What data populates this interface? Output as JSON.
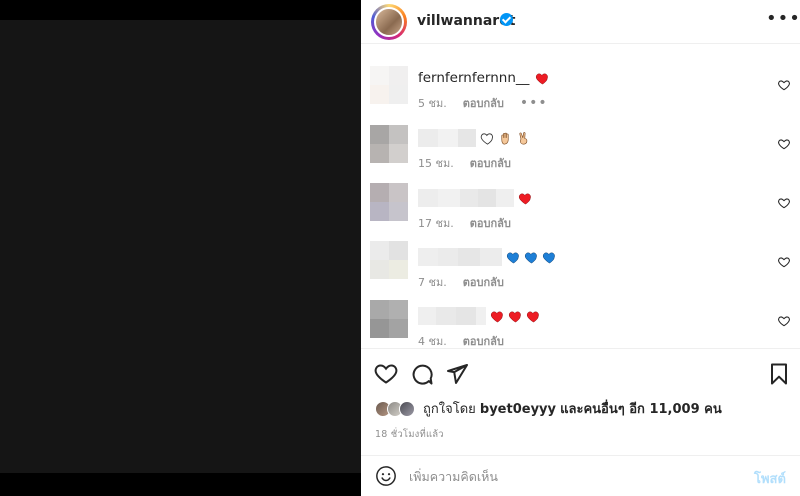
{
  "header": {
    "username": "villwannarot",
    "more_label": "•••"
  },
  "comments": [
    {
      "name": "fernfernfernnn__",
      "emojis": [
        "red-heart"
      ],
      "time": "5 ชม.",
      "reply": "ตอบกลับ",
      "more": "•••"
    },
    {
      "name": "",
      "emojis": [
        "white-heart",
        "raised-hand",
        "victory-hand"
      ],
      "time": "15 ชม.",
      "reply": "ตอบกลับ"
    },
    {
      "name": "",
      "emojis": [
        "red-heart"
      ],
      "time": "17 ชม.",
      "reply": "ตอบกลับ"
    },
    {
      "name": "",
      "emojis": [
        "blue-heart",
        "blue-heart",
        "blue-heart"
      ],
      "time": "7 ชม.",
      "reply": "ตอบกลับ"
    },
    {
      "name": "",
      "emojis": [
        "red-heart",
        "red-heart",
        "red-heart"
      ],
      "time": "4 ชม.",
      "reply": "ตอบกลับ"
    }
  ],
  "likes": {
    "prefix": "ถูกใจโดย",
    "user": "byet0eyyy",
    "and_others": "และคนอื่นๆ อีก 11,009 คน"
  },
  "timestamp": "18 ชั่วโมงที่แล้ว",
  "add_comment": {
    "placeholder": "เพิ่มความคิดเห็น",
    "post_label": "โพสต์"
  },
  "colors": {
    "accent": "#0095f6",
    "heart_red": "#ed1c24",
    "heart_blue": "#1e7fd6",
    "post_disabled": "#b2dffc"
  }
}
